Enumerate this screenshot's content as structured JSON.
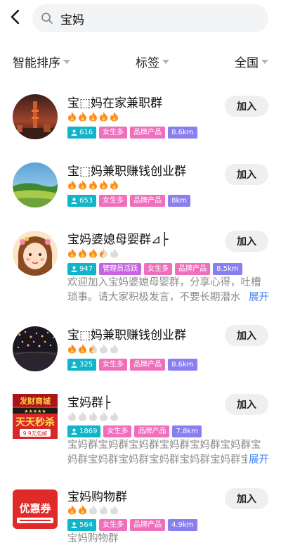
{
  "search": {
    "query": "宝妈"
  },
  "filters": [
    {
      "label": "智能排序"
    },
    {
      "label": "标签"
    },
    {
      "label": "全国"
    }
  ],
  "join_label": "加入",
  "groups": [
    {
      "title": "宝⬚妈在家兼职群",
      "heat": 5,
      "members": "616",
      "tags": [
        "女生多",
        "品牌产品"
      ],
      "distance": "8.6km",
      "description": ""
    },
    {
      "title": "宝⬚妈兼职赚钱创业群",
      "heat": 5,
      "members": "653",
      "tags": [
        "女生多",
        "品牌产品"
      ],
      "distance": "8km",
      "description": ""
    },
    {
      "title": "宝妈婆媳母婴群⊿├",
      "heat": 3.5,
      "members": "947",
      "tags": [
        "管理员活跃",
        "女生多",
        "品牌产品"
      ],
      "distance": "8.5km",
      "description": "欢迎加入宝妈婆媳母婴群，分享心得，吐槽琐事。请大家积极发言，不要长期潜水",
      "expand": "展开"
    },
    {
      "title": "宝⬚妈兼职赚钱创业群",
      "heat": 2.5,
      "members": "325",
      "tags": [
        "女生多",
        "品牌产品"
      ],
      "distance": "8.6km",
      "description": ""
    },
    {
      "title": "宝妈群├",
      "heat": 0,
      "members": "1869",
      "tags": [
        "女生多",
        "品牌产品"
      ],
      "distance": "7.8km",
      "description": "宝妈群宝妈群宝妈群宝妈群宝妈群宝妈群宝妈群宝妈群宝妈群宝妈群宝妈群宝妈群宝妈",
      "expand": "展开"
    },
    {
      "title": "宝妈购物群",
      "heat": 2,
      "members": "564",
      "tags": [
        "女生多",
        "品牌产品"
      ],
      "distance": "4.9km",
      "description": "宝妈购物群"
    }
  ],
  "avatar_texts": {
    "g5_top": "发财商城",
    "g5_main": "天天秒杀",
    "g5_sub": "9.9元包邮",
    "g6_main": "优惠券"
  },
  "colors": {
    "flame_on": "#ff8a1f",
    "flame_off": "#dcdcdc",
    "member_tag": "#11b5c9",
    "tag_pink": "#f06fbd",
    "tag_purple": "#c764e1",
    "distance_tag": "#8a7ff0",
    "expand_link": "#3b82f6"
  }
}
